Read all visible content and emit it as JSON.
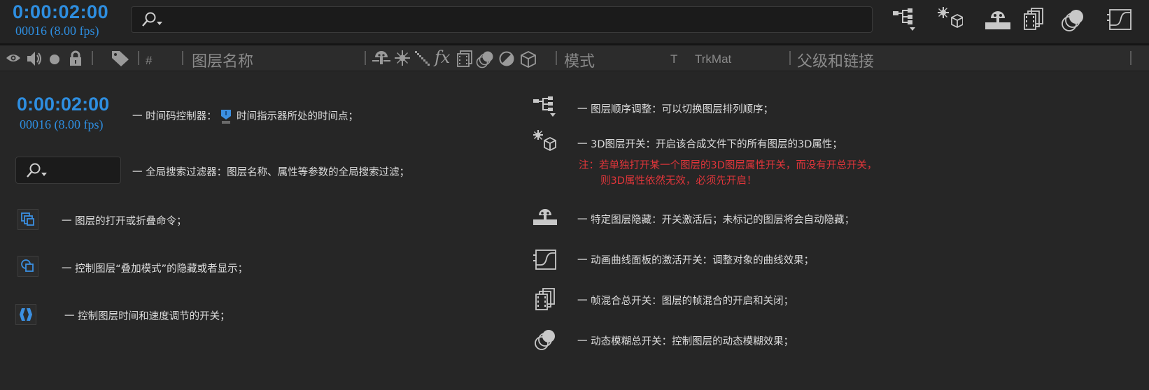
{
  "colors": {
    "accent": "#2e8ee0",
    "note": "#e0353a",
    "icon": "#c8c8c8",
    "background": "#262626"
  },
  "topbar": {
    "timecode": "0:00:02:00",
    "frames": "00016 (8.00 fps)",
    "search_placeholder": "",
    "icons": [
      "layer-order-icon",
      "3d-layer-icon",
      "shy-layers-icon",
      "frame-blending-icon",
      "motion-blur-icon",
      "graph-editor-icon"
    ]
  },
  "columns": {
    "layer_name": "图层名称",
    "mode": "模式",
    "t": "T",
    "trkmat": "TrkMat",
    "parent": "父级和链接",
    "label_hash": "#",
    "icons": [
      "eye-icon",
      "speaker-icon",
      "solo-icon",
      "lock-icon",
      "label-tag-icon",
      "shy-icon",
      "collapse-icon",
      "quality-icon",
      "fx-icon",
      "frame-blend-icon",
      "motion-blur-icon",
      "adjustment-icon",
      "3d-icon"
    ]
  },
  "legend": {
    "timecode": "0:00:02:00",
    "frames": "00016 (8.00 fps)",
    "timecode_desc_a": "一 时间码控制器：",
    "timecode_desc_b": "时间指示器所处的时间点；",
    "search_desc": "一 全局搜索过滤器：图层名称、属性等参数的全局搜索过滤；",
    "switches_desc": "一 图层的打开或折叠命令；",
    "modes_desc": "一 控制图层“叠加模式”的隐藏或者显示；",
    "timing_desc": "一 控制图层时间和速度调节的开关；",
    "order_desc": "一 图层顺序调整：可以切换图层排列顺序；",
    "threed_desc": "一 3D图层开关：开启该合成文件下的所有图层的3D属性；",
    "threed_note_1": "注：若单独打开某一个图层的3D图层属性开关，而没有开总开关，",
    "threed_note_2": "则3D属性依然无效，必须先开启！",
    "shy_desc": "一 特定图层隐藏：开关激活后；未标记的图层将会自动隐藏；",
    "graph_desc": "一 动画曲线面板的激活开关：调整对象的曲线效果；",
    "frameblend_desc": "一 帧混合总开关：图层的帧混合的开启和关闭；",
    "motionblur_desc": "一 动态模糊总开关：控制图层的动态模糊效果；"
  }
}
